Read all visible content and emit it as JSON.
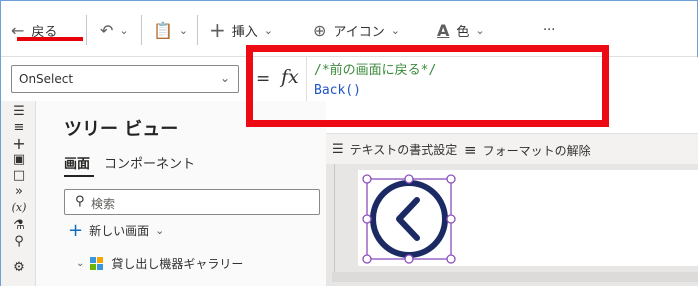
{
  "toolbar": {
    "back_label": "戻る",
    "insert_label": "挿入",
    "icon_label": "アイコン",
    "color_label": "色",
    "more_label": "···"
  },
  "formula_bar": {
    "property": "OnSelect",
    "equals": "=",
    "fx": "fx",
    "code_line1": "/*前の画面に戻る*/",
    "code_line2": "Back()"
  },
  "tree_view": {
    "title": "ツリー ビュー",
    "tab_screens": "画面",
    "tab_components": "コンポーネント",
    "search_placeholder": "検索",
    "new_screen": "新しい画面",
    "item_label": "貸し出し機器ギャラリー"
  },
  "format_bar": {
    "text_format": "テキストの書式設定",
    "clear_format": "フォーマットの解除"
  },
  "rail": {
    "variable_glyph": "(x)"
  },
  "colors": {
    "highlight": "#ee0a14",
    "accent": "#0f6cbd",
    "icon_navy": "#1b2a63",
    "selection": "#8c4fbd"
  }
}
